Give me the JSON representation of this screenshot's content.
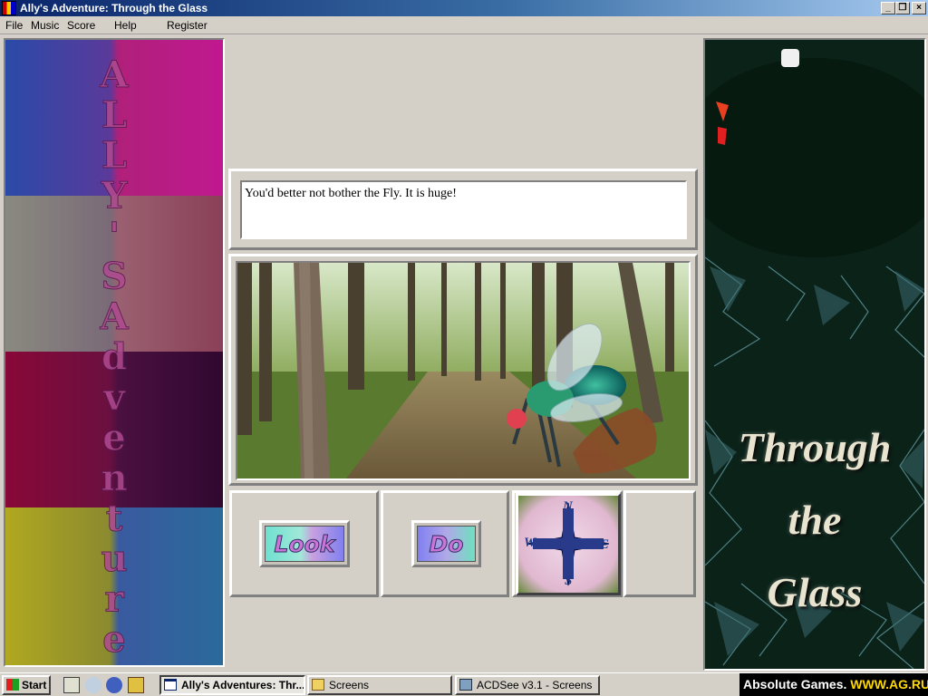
{
  "window": {
    "title": "Ally's Adventure: Through the Glass",
    "controls": {
      "minimize": "_",
      "restore": "❐",
      "close": "×"
    }
  },
  "menu": [
    "File",
    "Music",
    "Score",
    "Help",
    "Register"
  ],
  "left_banner": {
    "text": "Ally's Adventure",
    "letters": [
      "A",
      "L",
      "L",
      "Y",
      "'",
      "S",
      "A",
      "d",
      "v",
      "e",
      "n",
      "t",
      "u",
      "r",
      "e"
    ],
    "band_colors": [
      "#6a3a9a",
      "#8a6070",
      "#6a1040",
      "#8a8a30"
    ]
  },
  "message": "You'd better not bother the Fly.  It is huge!",
  "scene": {
    "subject": "giant fly in forest"
  },
  "buttons": {
    "look": "Look",
    "do": "Do"
  },
  "compass": {
    "n": "N",
    "s": "S",
    "e": "E",
    "w": "W"
  },
  "right_banner": {
    "title_lines": [
      "Through",
      "the",
      "Glass"
    ],
    "background": "#0b2218"
  },
  "taskbar": {
    "start": "Start",
    "quicklaunch_icons": [
      "desktop-icon",
      "music-note-icon",
      "gear-icon",
      "stack-icon"
    ],
    "tasks": [
      {
        "label": "Ally's Adventures: Thr...",
        "active": true,
        "icon": "window-icon"
      },
      {
        "label": "Screens",
        "active": false,
        "icon": "folder-icon"
      },
      {
        "label": "ACDSee v3.1 - Screens",
        "active": false,
        "icon": "acdsee-icon"
      }
    ],
    "tray_left": "Absolute Games.",
    "tray_right": "WWW.AG.RU"
  }
}
